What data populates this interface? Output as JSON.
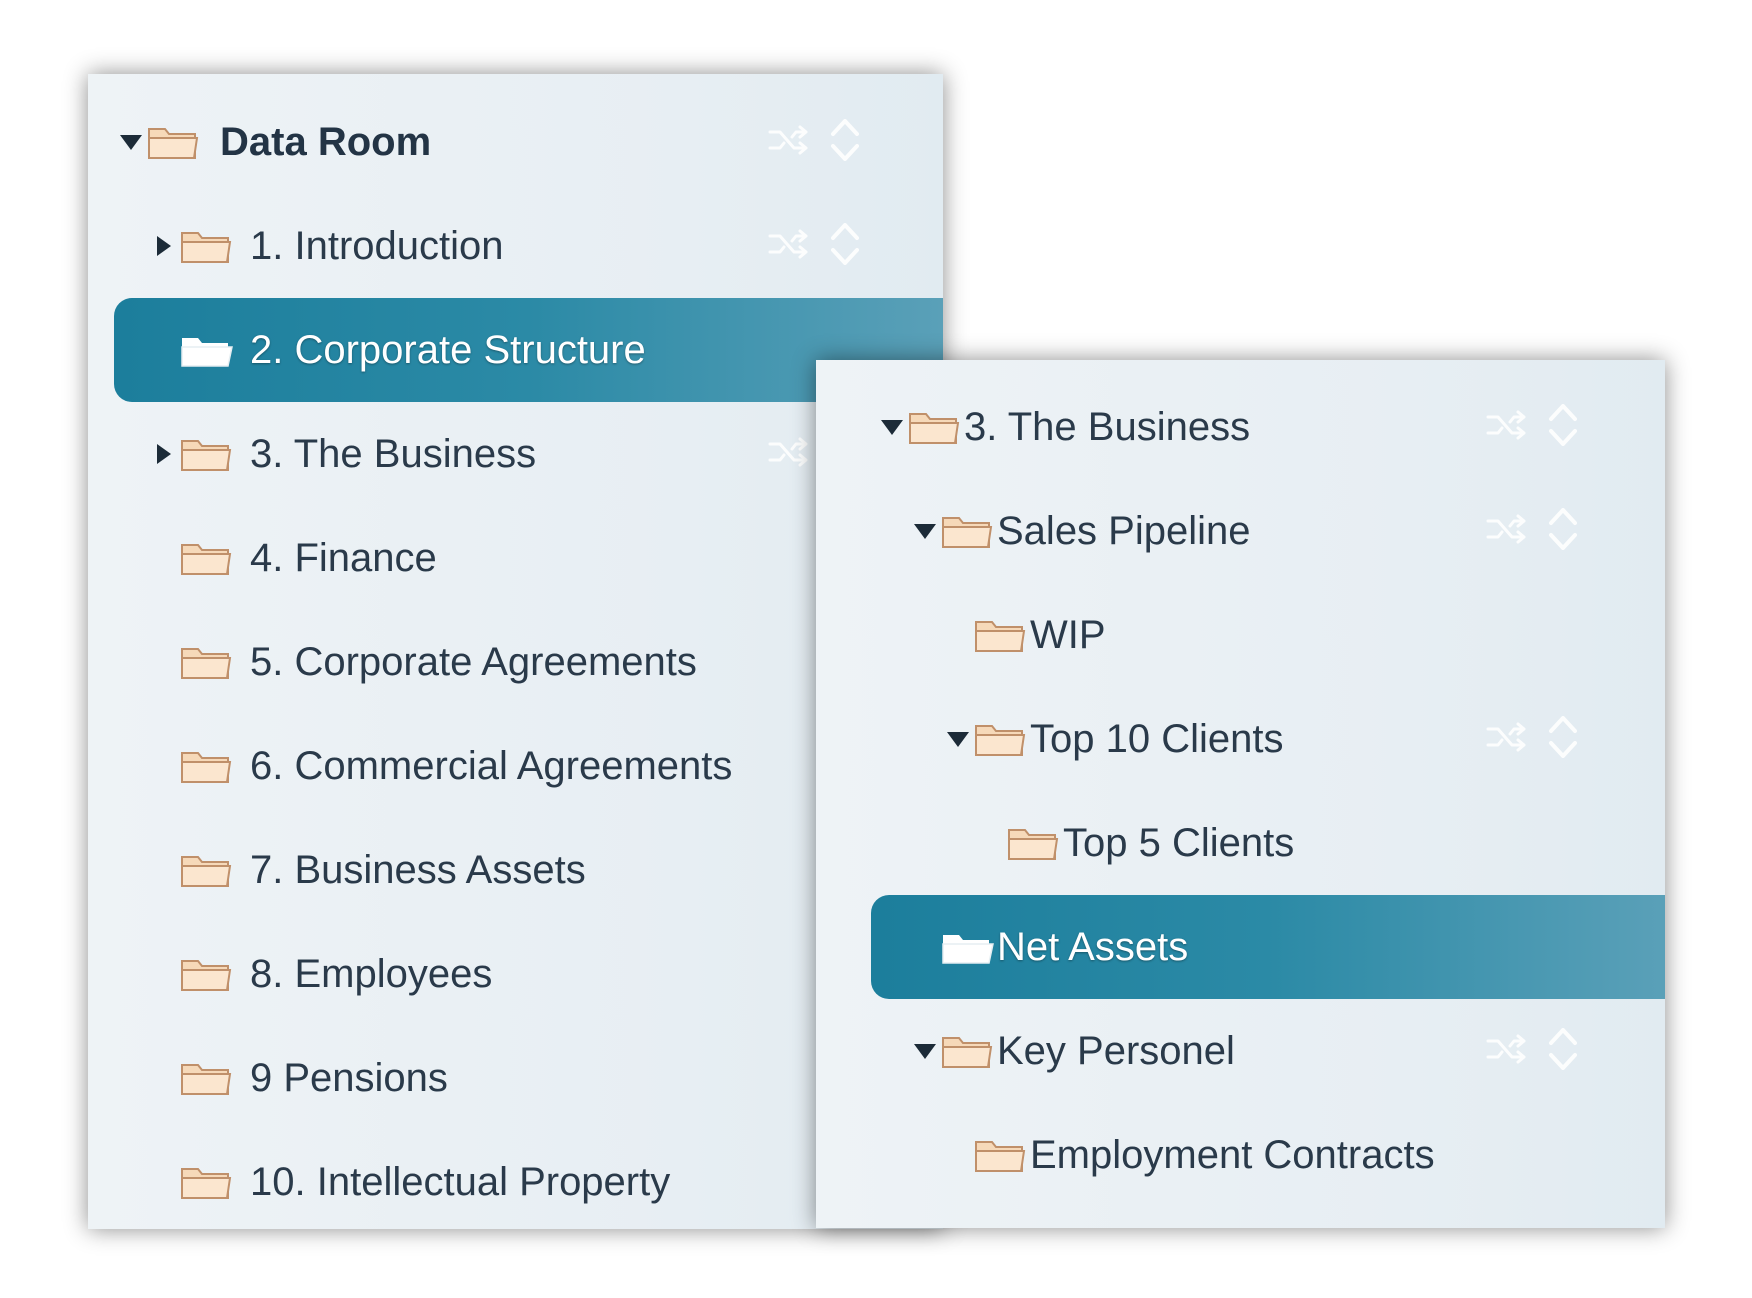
{
  "colors": {
    "panel_bg": "#e9f0f4",
    "selected_bg": "#2187a5",
    "folder_fill": "#f6d9b9",
    "folder_stroke": "#c0906a",
    "text": "#2a3a4a"
  },
  "left_panel": {
    "root": {
      "label": "Data Room",
      "expanded": true,
      "icon": "folder-icon"
    },
    "items": [
      {
        "label": "1. Introduction",
        "has_children": true,
        "expanded": false,
        "selected": false,
        "show_actions": true
      },
      {
        "label": "2. Corporate Structure",
        "has_children": false,
        "selected": true,
        "show_actions": false
      },
      {
        "label": "3. The Business",
        "has_children": true,
        "expanded": false,
        "selected": false,
        "show_actions": true
      },
      {
        "label": "4. Finance",
        "has_children": false,
        "selected": false,
        "show_actions": false
      },
      {
        "label": "5. Corporate Agreements",
        "has_children": false,
        "selected": false,
        "show_actions": false
      },
      {
        "label": "6. Commercial Agreements",
        "has_children": false,
        "selected": false,
        "show_actions": false
      },
      {
        "label": "7. Business Assets",
        "has_children": false,
        "selected": false,
        "show_actions": false
      },
      {
        "label": "8. Employees",
        "has_children": false,
        "selected": false,
        "show_actions": false
      },
      {
        "label": "9 Pensions",
        "has_children": false,
        "selected": false,
        "show_actions": false
      },
      {
        "label": "10. Intellectual Property",
        "has_children": false,
        "selected": false,
        "show_actions": false
      }
    ]
  },
  "right_panel": {
    "items": [
      {
        "label": "3. The Business",
        "level": 0,
        "has_children": true,
        "expanded": true,
        "selected": false,
        "show_actions": true
      },
      {
        "label": "Sales Pipeline",
        "level": 1,
        "has_children": true,
        "expanded": true,
        "selected": false,
        "show_actions": true
      },
      {
        "label": "WIP",
        "level": 2,
        "has_children": false,
        "selected": false,
        "show_actions": false
      },
      {
        "label": "Top 10 Clients",
        "level": 2,
        "has_children": true,
        "expanded": true,
        "selected": false,
        "show_actions": true
      },
      {
        "label": "Top 5 Clients",
        "level": 3,
        "has_children": false,
        "selected": false,
        "show_actions": false
      },
      {
        "label": "Net Assets",
        "level": 1,
        "has_children": false,
        "selected": true,
        "show_actions": false
      },
      {
        "label": "Key Personel",
        "level": 1,
        "has_children": true,
        "expanded": true,
        "selected": false,
        "show_actions": true
      },
      {
        "label": "Employment Contracts",
        "level": 2,
        "has_children": false,
        "selected": false,
        "show_actions": false
      }
    ]
  },
  "icons": {
    "folder": "folder-icon",
    "folder_selected": "folder-open-white-icon",
    "expand": "triangle-right-icon",
    "collapse": "triangle-down-icon",
    "reorder": "shuffle-icon",
    "sort": "sort-icon"
  }
}
